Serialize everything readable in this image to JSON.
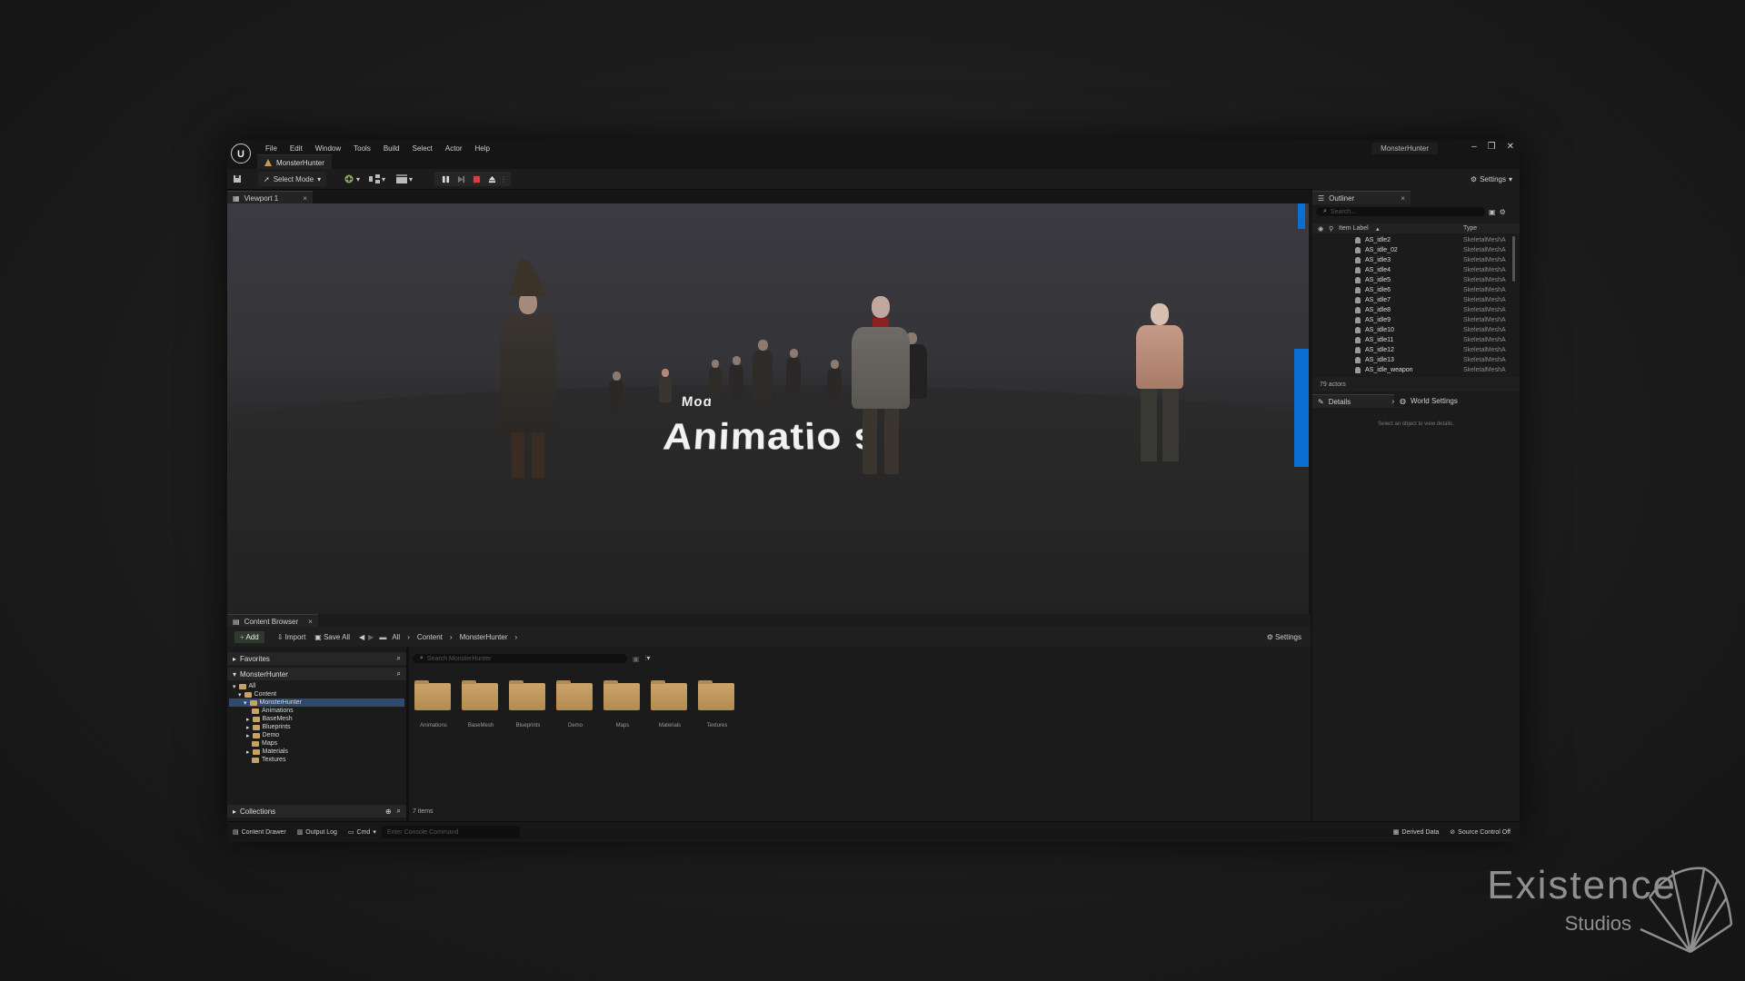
{
  "window": {
    "menu": [
      "File",
      "Edit",
      "Window",
      "Tools",
      "Build",
      "Select",
      "Actor",
      "Help"
    ],
    "project_tab": "MonsterHunter",
    "project_name": "MonsterHunter"
  },
  "toolbar": {
    "select_mode": "Select Mode",
    "settings": "Settings"
  },
  "viewport": {
    "tab": "Viewport 1",
    "text_small": "Mod",
    "text_big": "Animatio s"
  },
  "outliner": {
    "tab": "Outliner",
    "search_placeholder": "Search...",
    "col_label": "Item Label",
    "col_type": "Type",
    "items": [
      {
        "label": "AS_idle2",
        "type": "SkeletalMeshA"
      },
      {
        "label": "AS_idle_02",
        "type": "SkeletalMeshA"
      },
      {
        "label": "AS_idle3",
        "type": "SkeletalMeshA"
      },
      {
        "label": "AS_idle4",
        "type": "SkeletalMeshA"
      },
      {
        "label": "AS_idle5",
        "type": "SkeletalMeshA"
      },
      {
        "label": "AS_idle6",
        "type": "SkeletalMeshA"
      },
      {
        "label": "AS_idle7",
        "type": "SkeletalMeshA"
      },
      {
        "label": "AS_idle8",
        "type": "SkeletalMeshA"
      },
      {
        "label": "AS_idle9",
        "type": "SkeletalMeshA"
      },
      {
        "label": "AS_idle10",
        "type": "SkeletalMeshA"
      },
      {
        "label": "AS_idle11",
        "type": "SkeletalMeshA"
      },
      {
        "label": "AS_idle12",
        "type": "SkeletalMeshA"
      },
      {
        "label": "AS_idle13",
        "type": "SkeletalMeshA"
      },
      {
        "label": "AS_idle_weapon",
        "type": "SkeletalMeshA"
      }
    ],
    "count": "79 actors"
  },
  "details": {
    "tab": "Details",
    "world_tab": "World Settings",
    "empty_msg": "Select an object to view details."
  },
  "content_browser": {
    "tab": "Content Browser",
    "add": "Add",
    "import": "Import",
    "save_all": "Save All",
    "path": [
      "All",
      "Content",
      "MonsterHunter"
    ],
    "settings": "Settings",
    "favorites": "Favorites",
    "project_section": "MonsterHunter",
    "search_placeholder": "Search MonsterHunter",
    "tree": [
      {
        "label": "All"
      },
      {
        "label": "Content"
      },
      {
        "label": "MonsterHunter"
      },
      {
        "label": "Animations"
      },
      {
        "label": "BaseMesh"
      },
      {
        "label": "Blueprints"
      },
      {
        "label": "Demo"
      },
      {
        "label": "Maps"
      },
      {
        "label": "Materials"
      },
      {
        "label": "Textures"
      }
    ],
    "folders": [
      "Animations",
      "BaseMesh",
      "Blueprints",
      "Demo",
      "Maps",
      "Materials",
      "Textures"
    ],
    "collections": "Collections",
    "item_count": "7 items"
  },
  "statusbar": {
    "content_drawer": "Content Drawer",
    "output_log": "Output Log",
    "cmd": "Cmd",
    "console_placeholder": "Enter Console Command",
    "derived_data": "Derived Data",
    "source_control": "Source Control Off"
  },
  "watermark": {
    "line1": "Existence",
    "line2": "Studios"
  }
}
